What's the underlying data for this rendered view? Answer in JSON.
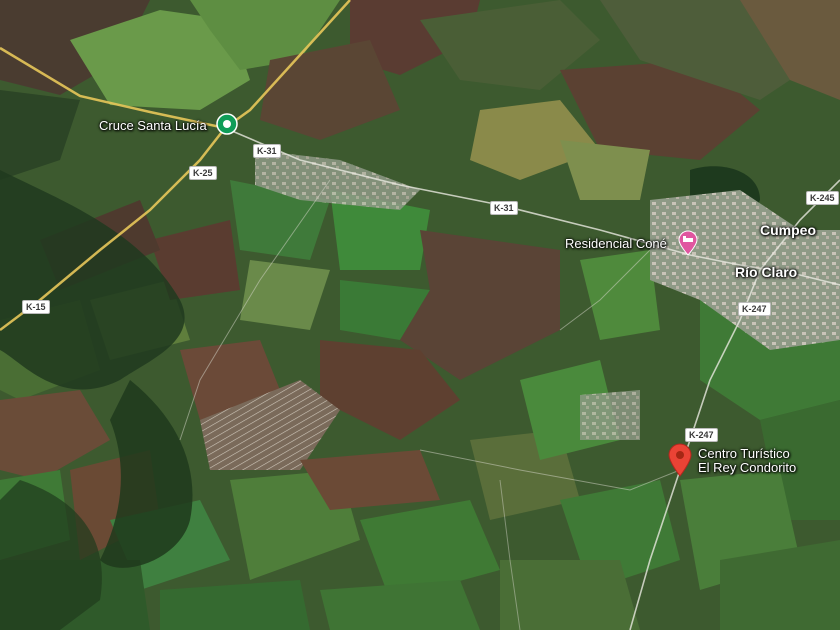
{
  "map": {
    "places": {
      "cruce": "Cruce Santa Lucía",
      "residencial": "Residencial Coné",
      "cumpeo": "Cumpeo",
      "rio_claro": "Río Claro",
      "centro_line1": "Centro Turístico",
      "centro_line2": "El Rey Condorito"
    },
    "road_shields": {
      "k31_a": "K-31",
      "k31_b": "K-31",
      "k25": "K-25",
      "k15": "K-15",
      "k245": "K-245",
      "k247_a": "K-247",
      "k247_b": "K-247"
    },
    "icons": {
      "transit": "bus-stop-pin-icon",
      "lodging": "bed-lodging-icon",
      "marker": "red-location-pin-icon"
    },
    "colors": {
      "road_yellow": "#e7c65a",
      "lodging_pink": "#e056a0",
      "transit_green": "#0f9d58",
      "marker_red": "#ea4335"
    }
  }
}
